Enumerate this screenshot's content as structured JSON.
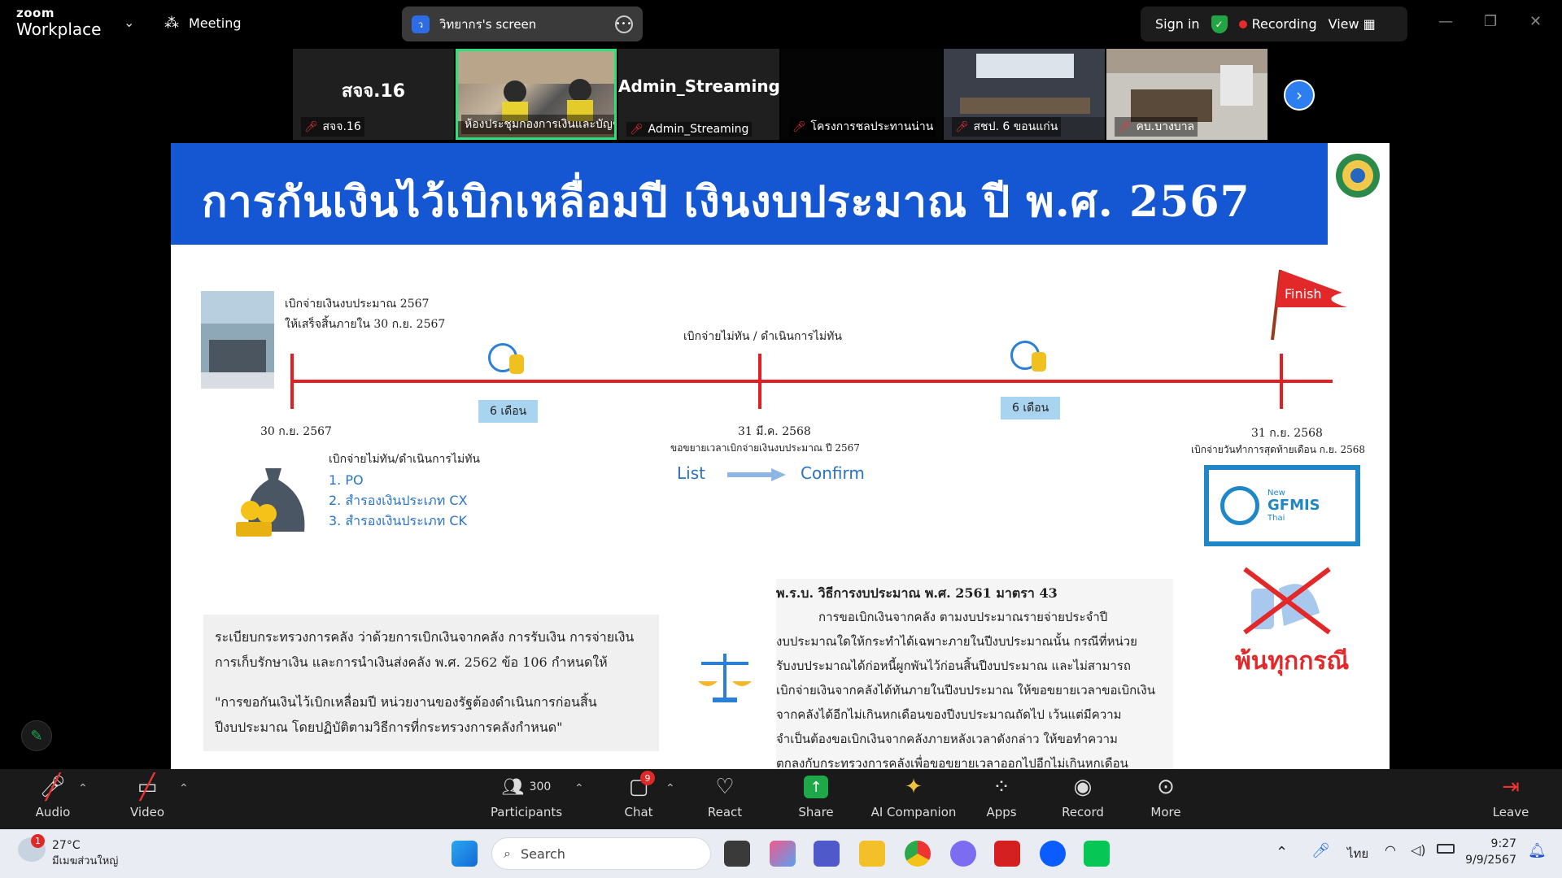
{
  "zoom": {
    "logo_small": "zoom",
    "logo_big": "Workplace",
    "meeting_label": "Meeting",
    "screen_label": "วิทยากร's screen",
    "signin": "Sign in",
    "recording": "Recording",
    "view": "View"
  },
  "participants": [
    {
      "big": "สจจ.16",
      "name": "สจจ.16"
    },
    {
      "big": "",
      "name": "ห้องประชุมกองการเงินและบัญชี"
    },
    {
      "big": "Admin_Streaming",
      "name": "Admin_Streaming"
    },
    {
      "big": "",
      "name": "โครงการชลประทานน่าน"
    },
    {
      "big": "",
      "name": "สชป. 6 ขอนแก่น"
    },
    {
      "big": "",
      "name": "คบ.บางบาล"
    }
  ],
  "slide": {
    "title": "การกันเงินไว้เบิกเหลื่อมปี เงินงบประมาณ ปี พ.ศ. 2567",
    "note_top": [
      "เบิกจ่ายเงินงบประมาณ 2567",
      "ให้เสร็จสิ้นภายใน 30 ก.ย. 2567"
    ],
    "mid_label": "เบิกจ่ายไม่ทัน / ดำเนินการไม่ทัน",
    "finish": "Finish",
    "six_months": "6 เดือน",
    "date1": "30 ก.ย. 2567",
    "date2": "31 มี.ค. 2568",
    "date2_sub": "ขอขยายเวลาเบิกจ่ายเงินงบประมาณ ปี 2567",
    "date3": "31 ก.ย. 2568",
    "date3_sub": "เบิกจ่ายวันทำการสุดท้ายเดือน ก.ย. 2568",
    "list": "List",
    "confirm": "Confirm",
    "late_title": "เบิกจ่ายไม่ทัน/ดำเนินการไม่ทัน",
    "late_items": [
      "1. PO",
      "2. สำรองเงินประเภท CX",
      "3. สำรองเงินประเภท CK"
    ],
    "gfmis_new": "New",
    "gfmis": "GFMIS",
    "gfmis_thai": "Thai",
    "pass": "พ้นทุกกรณี",
    "reg_line1": "ระเบียบกระทรวงการคลัง ว่าด้วยการเบิกเงินจากคลัง การรับเงิน การจ่ายเงิน",
    "reg_line2": "การเก็บรักษาเงิน และการนำเงินส่งคลัง พ.ศ. 2562 ข้อ 106 กำหนดให้",
    "reg_quote1": "\"การขอกันเงินไว้เบิกเหลื่อมปี หน่วยงานของรัฐต้องดำเนินการก่อนสิ้น",
    "reg_quote2": "ปีงบประมาณ โดยปฏิบัติตามวิธีการที่กระทรวงการคลังกำหนด\"",
    "law_title": "พ.ร.บ. วิธีการงบประมาณ พ.ศ. 2561 มาตรา 43",
    "law_lines": [
      "การขอเบิกเงินจากคลัง ตามงบประมาณรายจ่ายประจำปี",
      "งบประมาณใดให้กระทำได้เฉพาะภายในปีงบประมาณนั้น กรณีที่หน่วย",
      "รับงบประมาณได้ก่อหนี้ผูกพันไว้ก่อนสิ้นปีงบประมาณ และไม่สามารถ",
      "เบิกจ่ายเงินจากคลังได้ทันภายในปีงบประมาณ ให้ขอขยายเวลาขอเบิกเงิน",
      "จากคลังได้อีกไม่เกินหกเดือนของปีงบประมาณถัดไป เว้นแต่มีความ",
      "จำเป็นต้องขอเบิกเงินจากคลังภายหลังเวลาดังกล่าว ให้ขอทำความ",
      "ตกลงกับกระทรวงการคลังเพื่อขอขยายเวลาออกไปอีกไม่เกินหกเดือน"
    ]
  },
  "controls": {
    "audio": "Audio",
    "video": "Video",
    "participants": "Participants",
    "participants_count": "300",
    "chat": "Chat",
    "chat_badge": "9",
    "react": "React",
    "share": "Share",
    "ai": "AI Companion",
    "apps": "Apps",
    "record": "Record",
    "more": "More",
    "leave": "Leave"
  },
  "taskbar": {
    "temp": "27°C",
    "weather_badge": "1",
    "location": "มีเมฆส่วนใหญ่",
    "search": "Search",
    "lang": "ไทย",
    "time": "9:27",
    "date": "9/9/2567"
  },
  "colors": {
    "slide_blue": "#1556d2",
    "timeline_red": "#e31e24",
    "pill_blue": "#a8d4ef",
    "zoom_blue": "#2d7ff0"
  }
}
